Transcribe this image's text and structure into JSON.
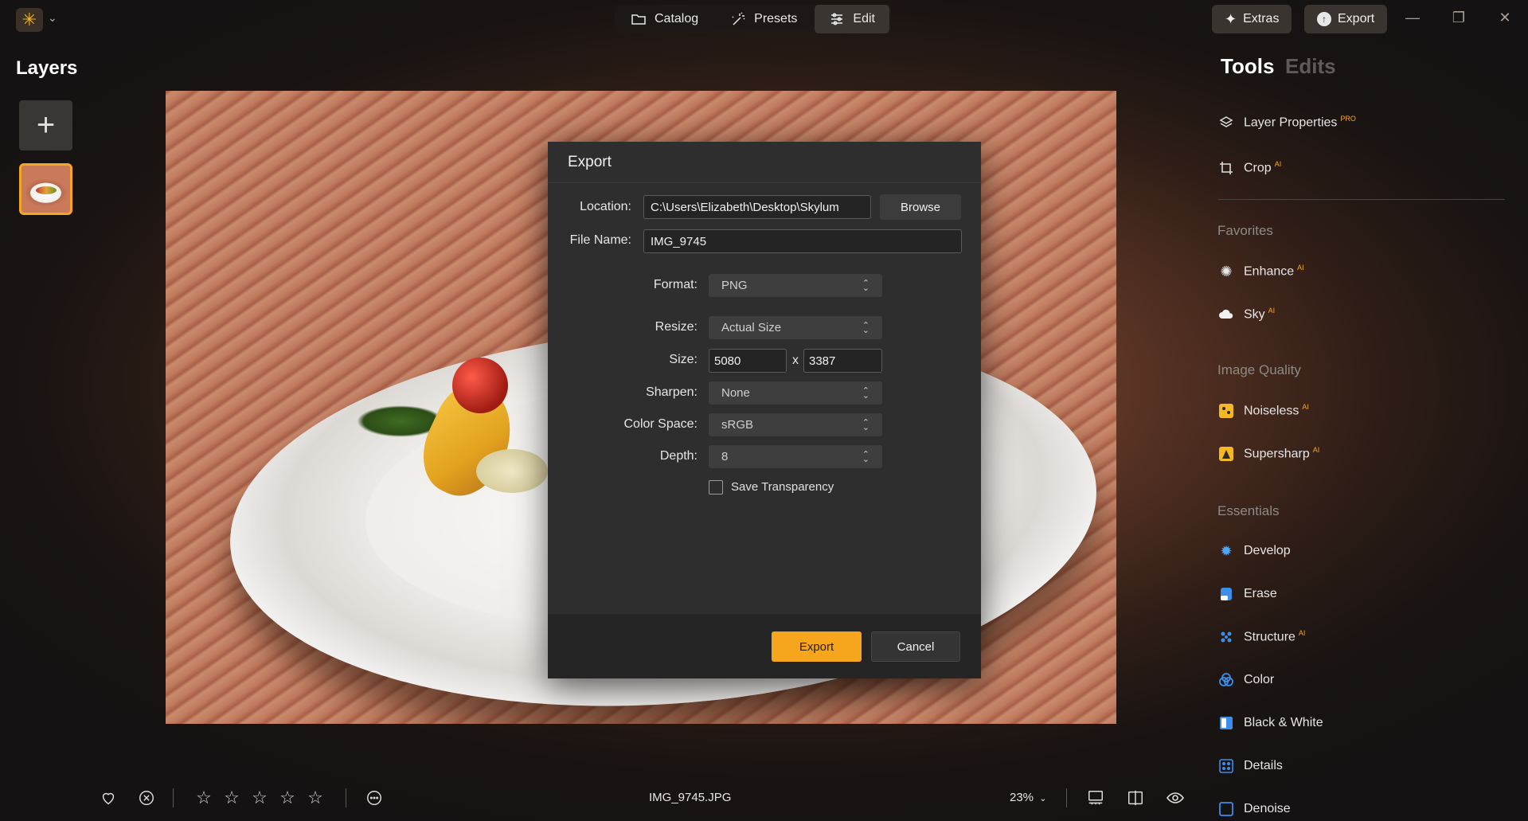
{
  "topbar": {
    "tabs": [
      {
        "label": "Catalog",
        "icon": "folder-icon"
      },
      {
        "label": "Presets",
        "icon": "magic-wand-icon"
      },
      {
        "label": "Edit",
        "icon": "sliders-icon"
      }
    ],
    "extras_label": "Extras",
    "export_label": "Export"
  },
  "layers": {
    "title": "Layers"
  },
  "tools_panel": {
    "tools_tab": "Tools",
    "edits_tab": "Edits",
    "top_items": [
      {
        "label": "Layer Properties",
        "badge": "PRO"
      },
      {
        "label": "Crop",
        "badge": "AI"
      }
    ],
    "favorites_label": "Favorites",
    "favorites": [
      {
        "label": "Enhance",
        "badge": "AI"
      },
      {
        "label": "Sky",
        "badge": "AI"
      }
    ],
    "image_quality_label": "Image Quality",
    "image_quality": [
      {
        "label": "Noiseless",
        "badge": "AI"
      },
      {
        "label": "Supersharp",
        "badge": "AI"
      }
    ],
    "essentials_label": "Essentials",
    "essentials": [
      {
        "label": "Develop",
        "badge": ""
      },
      {
        "label": "Erase",
        "badge": ""
      },
      {
        "label": "Structure",
        "badge": "AI"
      },
      {
        "label": "Color",
        "badge": ""
      },
      {
        "label": "Black & White",
        "badge": ""
      },
      {
        "label": "Details",
        "badge": ""
      },
      {
        "label": "Denoise",
        "badge": ""
      }
    ]
  },
  "bottom": {
    "filename": "IMG_9745.JPG",
    "zoom": "23%"
  },
  "dialog": {
    "title": "Export",
    "location_label": "Location:",
    "location_value": "C:\\Users\\Elizabeth\\Desktop\\Skylum",
    "browse_label": "Browse",
    "filename_label": "File Name:",
    "filename_value": "IMG_9745",
    "format_label": "Format:",
    "format_value": "PNG",
    "resize_label": "Resize:",
    "resize_value": "Actual Size",
    "size_label": "Size:",
    "width_value": "5080",
    "size_x": "x",
    "height_value": "3387",
    "sharpen_label": "Sharpen:",
    "sharpen_value": "None",
    "colorspace_label": "Color Space:",
    "colorspace_value": "sRGB",
    "depth_label": "Depth:",
    "depth_value": "8",
    "save_transparency_label": "Save Transparency",
    "save_transparency_checked": false,
    "export_button": "Export",
    "cancel_button": "Cancel"
  },
  "colors": {
    "accent": "#f6b21b",
    "export_button": "#f5a61d"
  }
}
